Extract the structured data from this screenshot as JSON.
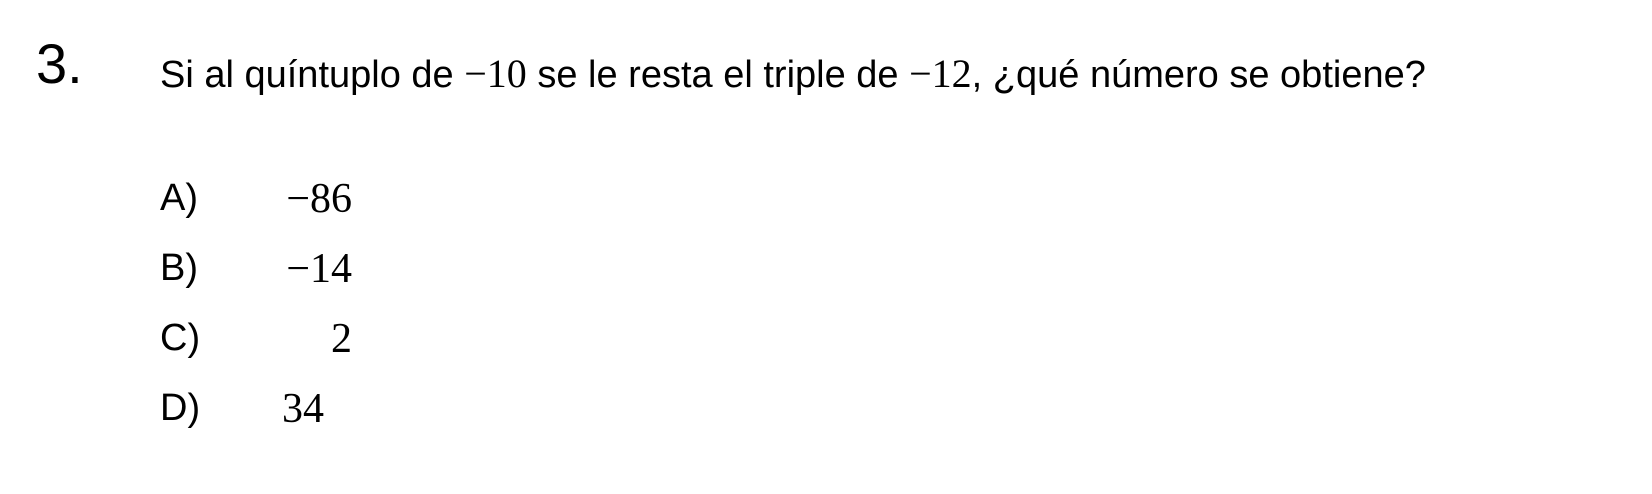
{
  "question": {
    "number": "3.",
    "stem_part1": "Si al quíntuplo de ",
    "value1": "−10",
    "stem_part2": " se le resta el triple de ",
    "value2": "−12",
    "stem_part3": ", ¿qué número se obtiene?"
  },
  "options": [
    {
      "letter": "A)",
      "value": "−86"
    },
    {
      "letter": "B)",
      "value": "−14"
    },
    {
      "letter": "C)",
      "value": "2"
    },
    {
      "letter": "D)",
      "value": "34"
    }
  ]
}
